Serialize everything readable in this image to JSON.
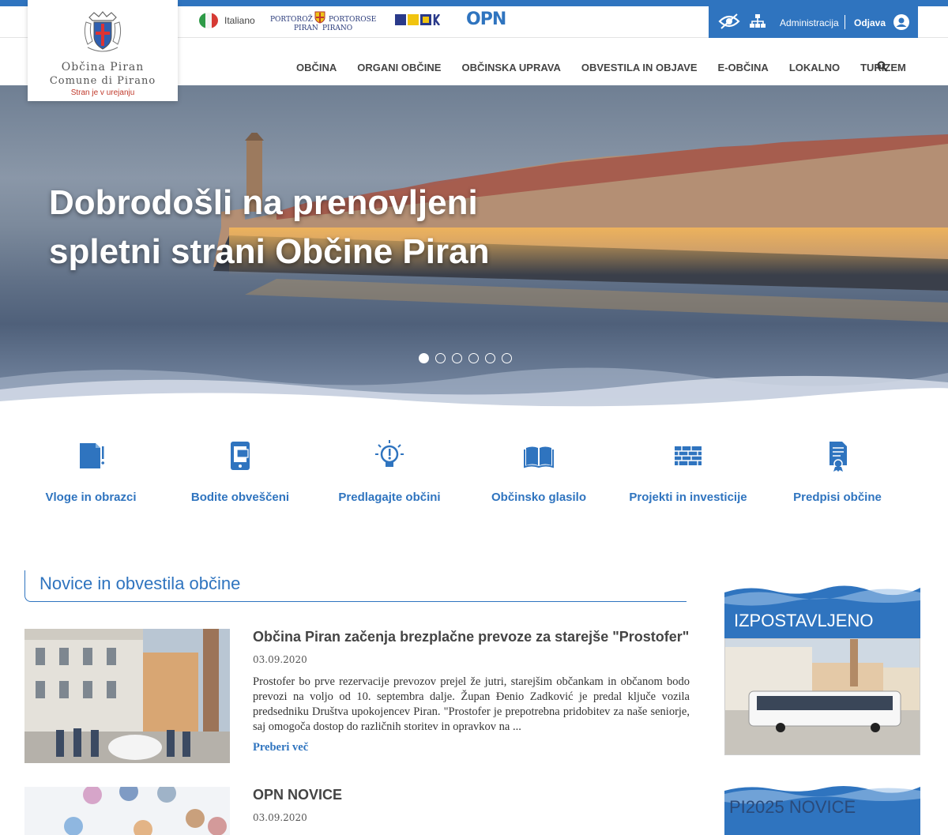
{
  "logo": {
    "line1": "Občina Piran",
    "line2": "Comune di Pirano",
    "note": "Stran je v urejanju"
  },
  "topbar": {
    "language": "Italiano",
    "partner_logo": {
      "left_top": "PORTOROŽ",
      "right_top": "PORTOROSE",
      "left_bottom": "PIRAN",
      "right_bottom": "PIRANO"
    },
    "opn_label": "OPN",
    "admin_label": "Administracija",
    "logout_label": "Odjava"
  },
  "nav": {
    "items": [
      "OBČINA",
      "ORGANI OBČINE",
      "OBČINSKA UPRAVA",
      "OBVESTILA IN OBJAVE",
      "E-OBČINA",
      "LOKALNO",
      "TURIZEM"
    ]
  },
  "hero": {
    "title": "Dobrodošli na prenovljeni spletni strani Občine Piran",
    "slides": 6,
    "active_slide": 1
  },
  "quick_links": [
    {
      "label": "Vloge in obrazci",
      "icon": "document-icon"
    },
    {
      "label": "Bodite obveščeni",
      "icon": "mobile-icon"
    },
    {
      "label": "Predlagajte občini",
      "icon": "lightbulb-icon"
    },
    {
      "label": "Občinsko glasilo",
      "icon": "book-icon"
    },
    {
      "label": "Projekti in investicije",
      "icon": "brick-wall-icon"
    },
    {
      "label": "Predpisi občine",
      "icon": "certificate-icon"
    }
  ],
  "news": {
    "heading": "Novice in obvestila občine",
    "articles": [
      {
        "title": "Občina Piran začenja brezplačne prevoze za starejše \"Prostofer\"",
        "date": "03.09.2020",
        "text": "Prostofer bo prve rezervacije prevozov prejel že jutri, starejšim občankam in občanom bodo prevozi na voljo od 10. septembra dalje. Župan Đenio Zadković je predal ključe vozila predsedniku Društva upokojencev Piran. \"Prostofer je prepotrebna pridobitev za naše seniorje, saj omogoča dostop do različnih storitev in opravkov na ...",
        "more": "Preberi več"
      },
      {
        "title": "OPN NOVICE",
        "date": "03.09.2020"
      }
    ]
  },
  "sidebar": {
    "featured_title": "IZPOSTAVLJENO",
    "pi2025_title": "PI2025 NOVICE"
  },
  "colors": {
    "accent": "#2f74bf",
    "text": "#444444",
    "note_red": "#c0392b"
  }
}
